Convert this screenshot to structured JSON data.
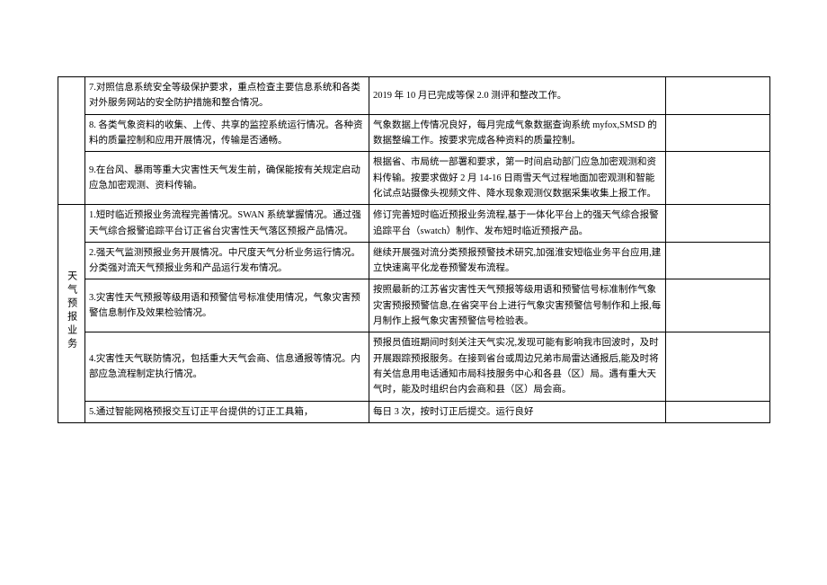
{
  "section1": {
    "rows": [
      {
        "item": "7.对照信息系统安全等级保护要求，重点检查主要信息系统和各类对外服务网站的安全防护措施和整合情况。",
        "note": "2019 年 10 月已完成等保 2.0 测评和整改工作。",
        "extra": ""
      },
      {
        "item": "8. 各类气象资料的收集、上传、共享的监控系统运行情况。各种资料的质量控制和应用开展情况，传输是否通畅。",
        "note": "气象数据上传情况良好，每月完成气象数据查询系统 myfox,SMSD 的数据整编工作。按要求完成各种资料的质量控制。",
        "extra": ""
      },
      {
        "item": "9.在台风、暴雨等重大灾害性天气发生前，确保能按有关规定启动应急加密观测、资料传输。",
        "note": "根据省、市局统一部署和要求，第一时间启动部门应急加密观测和资料传输。按要求做好 2 月 14-16 日雨雪天气过程地面加密观测和智能化试点站摄像头视频文件、降水现象观测仪数据采集收集上报工作。",
        "extra": ""
      }
    ]
  },
  "section2": {
    "category": "天气预报业务",
    "rows": [
      {
        "item": "1.短时临近预报业务流程完善情况。SWAN 系统掌握情况。通过强天气综合报警追踪平台订正省台灾害性天气落区预报产品情况。",
        "note": "修订完善短时临近预报业务流程,基于一体化平台上的强天气综合报警追踪平台（swatch）制作、发布短时临近预报产品。",
        "extra": ""
      },
      {
        "item": "2.强天气监测预报业务开展情况。中尺度天气分析业务运行情况。分类强对流天气预报业务和产品运行发布情况。",
        "note": "继续开展强对流分类预报预警技术研究,加强淮安短临业务平台应用,建立快速离平化龙卷预警发布流程。",
        "extra": ""
      },
      {
        "item": "3.灾害性天气预报等级用语和预警信号标准使用情况，气象灾害预警信息制作及效果检验情况。",
        "note": "按照最新的江苏省灾害性天气预报等级用语和预警信号标准制作气象灾害预报预警信息,在省突平台上进行气象灾害预警信号制作和上报,每月制作上报气象灾害预警信号检验表。",
        "extra": ""
      },
      {
        "item": "4.灾害性天气联防情况，包括重大天气会商、信息通报等情况。内部应急流程制定执行情况。",
        "note": "预报员值班期间时刻关注天气实况,发现可能有影响我市回波时，及时开展跟踪预报服务。在接到省台或周边兄弟市局雷达通报后,能及时将有关信息用电话通知市局科技服务中心和各县（区）局。遇有重大天气时，能及时组织台内会商和县（区）局会商。",
        "extra": ""
      },
      {
        "item": "5.通过智能网格预报交互订正平台提供的订正工具箱，",
        "note": "每日 3 次，按时订正后提交。运行良好",
        "extra": ""
      }
    ]
  }
}
